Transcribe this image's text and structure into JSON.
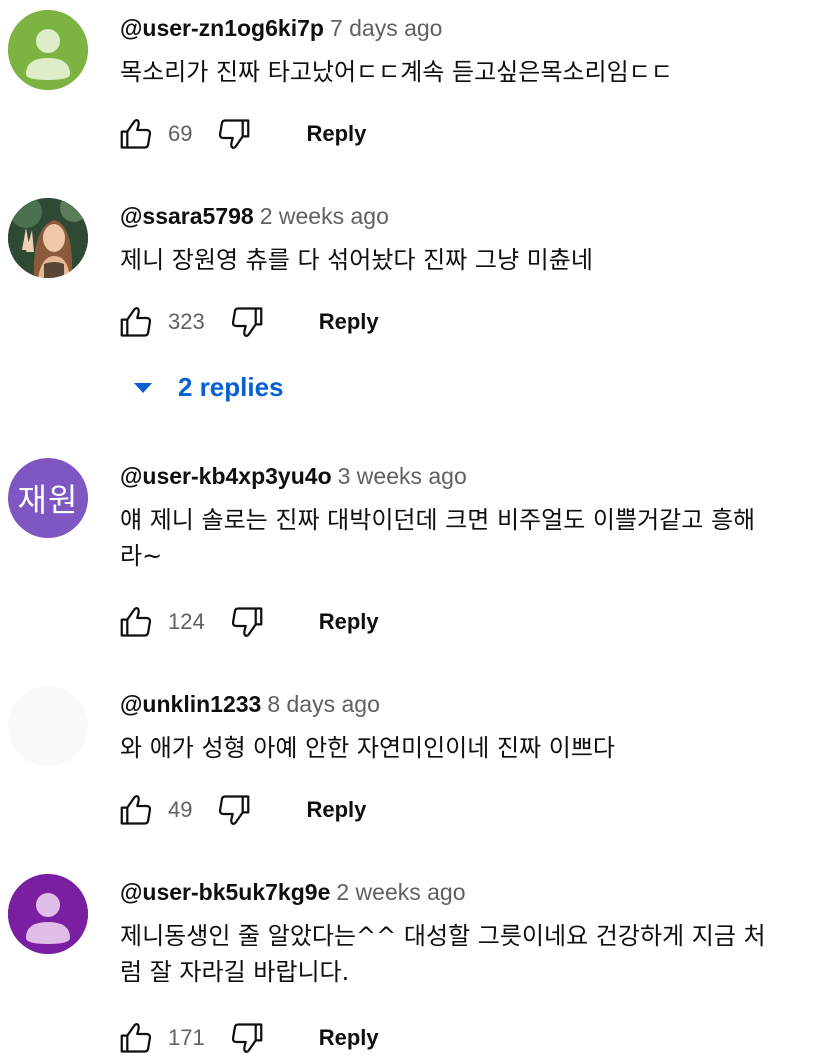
{
  "comments": [
    {
      "author": "@user-zn1og6ki7p",
      "time": "7 days ago",
      "text": "목소리가  진짜 타고났어ㄷㄷ계속 듣고싶은목소리임ㄷㄷ",
      "likes": "69",
      "reply_label": "Reply",
      "avatar": {
        "type": "default-person",
        "color": "#7cb342"
      }
    },
    {
      "author": "@ssara5798",
      "time": "2 weeks ago",
      "text": "제니 장원영 츄를 다 섞어놨다 진짜 그냥 미츈네",
      "likes": "323",
      "reply_label": "Reply",
      "avatar": {
        "type": "photo"
      }
    },
    {
      "author": "@user-kb4xp3yu4o",
      "time": "3 weeks ago",
      "text": "얘 제니 솔로는 진짜 대박이던데 크면 비주얼도 이쁠거같고 흥해라~",
      "likes": "124",
      "reply_label": "Reply",
      "avatar": {
        "type": "initials",
        "label": "재원",
        "color": "#7e57c2"
      }
    },
    {
      "author": "@unklin1233",
      "time": "8 days ago",
      "text": "와 애가 성형 아예 안한 자연미인이네 진짜 이쁘다",
      "likes": "49",
      "reply_label": "Reply",
      "avatar": {
        "type": "blank",
        "color": "#f9f9f9"
      }
    },
    {
      "author": "@user-bk5uk7kg9e",
      "time": "2 weeks ago",
      "text": "제니동생인 줄 알았다는^^ 대성할 그릇이네요 건강하게 지금 처럼 잘 자라길 바랍니다.",
      "likes": "171",
      "reply_label": "Reply",
      "avatar": {
        "type": "default-person",
        "color": "#7b1fa2"
      }
    }
  ],
  "replies_toggle": {
    "label": "2 replies",
    "icon": "caret-down-icon",
    "color": "#065fd4"
  },
  "icons": {
    "like": "thumbs-up-icon",
    "dislike": "thumbs-down-icon"
  }
}
